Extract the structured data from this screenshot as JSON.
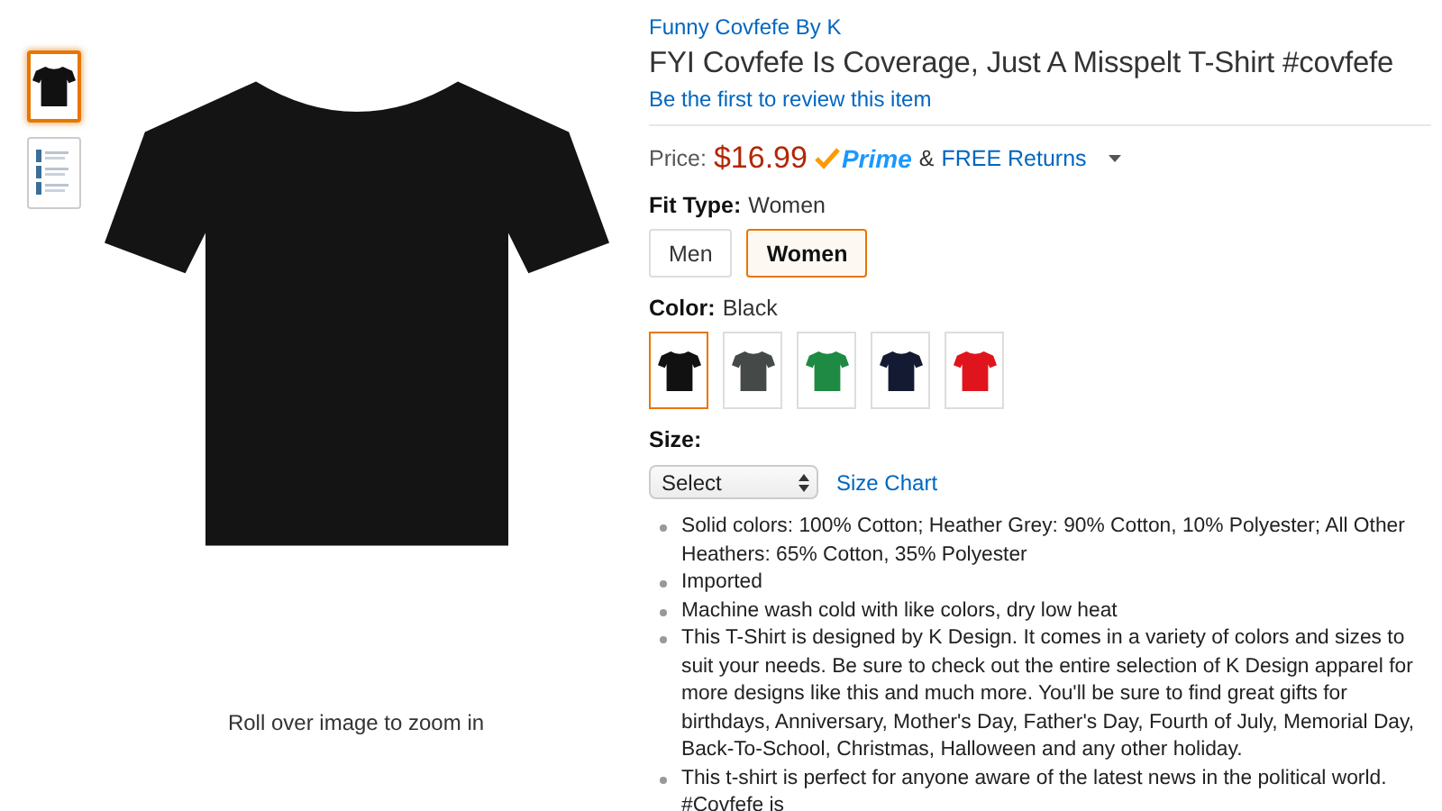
{
  "gallery": {
    "thumbnails": [
      {
        "kind": "shirt",
        "selected": true
      },
      {
        "kind": "chart",
        "selected": false
      }
    ],
    "zoom_hint": "Roll over image to zoom in"
  },
  "product": {
    "brand": "Funny Covfefe By K",
    "title": "FYI Covfefe Is Coverage, Just A Misspelt T-Shirt #covfefe",
    "review_link": "Be the first to review this item",
    "price": {
      "label": "Price:",
      "amount": "$16.99",
      "prime": "Prime",
      "returns_prefix": "&",
      "returns": "FREE Returns"
    },
    "fit_type": {
      "label": "Fit Type:",
      "value": "Women",
      "options": [
        {
          "label": "Men",
          "selected": false
        },
        {
          "label": "Women",
          "selected": true
        }
      ]
    },
    "color": {
      "label": "Color:",
      "value": "Black",
      "swatches": [
        {
          "color": "#111111",
          "selected": true
        },
        {
          "color": "#454a48",
          "selected": false
        },
        {
          "color": "#1f8a43",
          "selected": false
        },
        {
          "color": "#151a33",
          "selected": false
        },
        {
          "color": "#e0141c",
          "selected": false
        }
      ]
    },
    "size": {
      "label": "Size:",
      "select": "Select",
      "size_chart": "Size Chart"
    },
    "bullets": [
      "Solid colors: 100% Cotton; Heather Grey: 90% Cotton, 10% Polyester; All Other Heathers: 65% Cotton, 35% Polyester",
      "Imported",
      "Machine wash cold with like colors, dry low heat",
      "This T-Shirt is designed by K Design. It comes in a variety of colors and sizes to suit your needs. Be sure to check out the entire selection of K Design apparel for more designs like this and much more. You'll be sure to find great gifts for birthdays, Anniversary, Mother's Day, Father's Day, Fourth of July, Memorial Day, Back-To-School, Christmas, Halloween and any other holiday.",
      "This t-shirt is perfect for anyone aware of the latest news in the political world. #Covfefe is"
    ]
  }
}
